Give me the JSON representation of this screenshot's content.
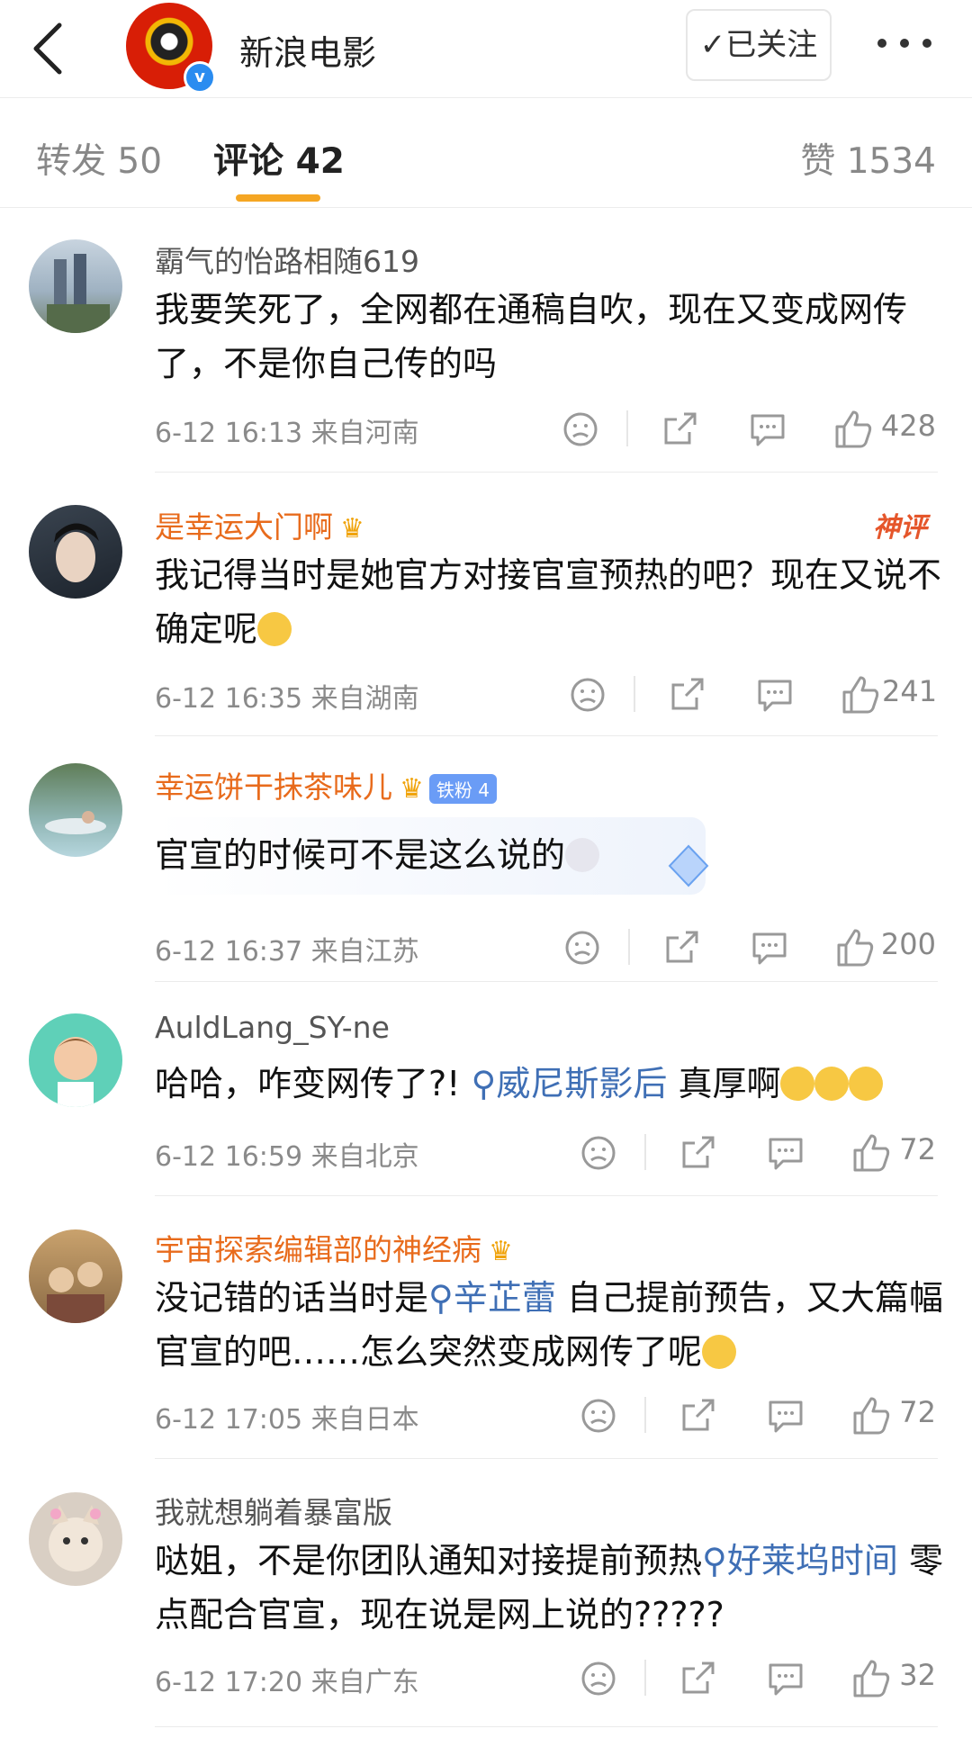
{
  "header": {
    "account_name": "新浪电影",
    "follow_label": "✓已关注"
  },
  "tabs": {
    "repost": "转发 50",
    "comment": "评论 42",
    "like": "赞 1534"
  },
  "shenping_label": "神评",
  "fan_badge": "铁粉 4",
  "comments": [
    {
      "user": "霸气的怡路相随619",
      "text": "我要笑死了，全网都在通稿自吹，现在又变成网传了，不是你自己传的吗",
      "time": "6-12 16:13 来自河南",
      "likes": "428"
    },
    {
      "user": "是幸运大门啊",
      "text": "我记得当时是她官方对接官宣预热的吧？现在又说不确定呢",
      "time": "6-12 16:35 来自湖南",
      "likes": "241"
    },
    {
      "user": "幸运饼干抹茶味儿",
      "text": "官宣的时候可不是这么说的",
      "time": "6-12 16:37 来自江苏",
      "likes": "200"
    },
    {
      "user": "AuldLang_SY-ne",
      "text_a": "哈哈，咋变网传了?!",
      "topic": "威尼斯影后",
      "text_b": " 真厚啊",
      "time": "6-12 16:59 来自北京",
      "likes": "72"
    },
    {
      "user": "宇宙探索编辑部的神经病",
      "text_a": "没记错的话当时是",
      "topic": "辛芷蕾",
      "text_b": " 自己提前预告，又大篇幅官宣的吧……怎么突然变成网传了呢",
      "time": "6-12 17:05 来自日本",
      "likes": "72"
    },
    {
      "user": "我就想躺着暴富版",
      "text_a": "哒姐，不是你团队通知对接提前预热",
      "topic": "好莱坞时间",
      "text_b": " 零点配合官宣，现在说是网上说的?????",
      "time": "6-12 17:20 来自广东",
      "likes": "32"
    }
  ]
}
